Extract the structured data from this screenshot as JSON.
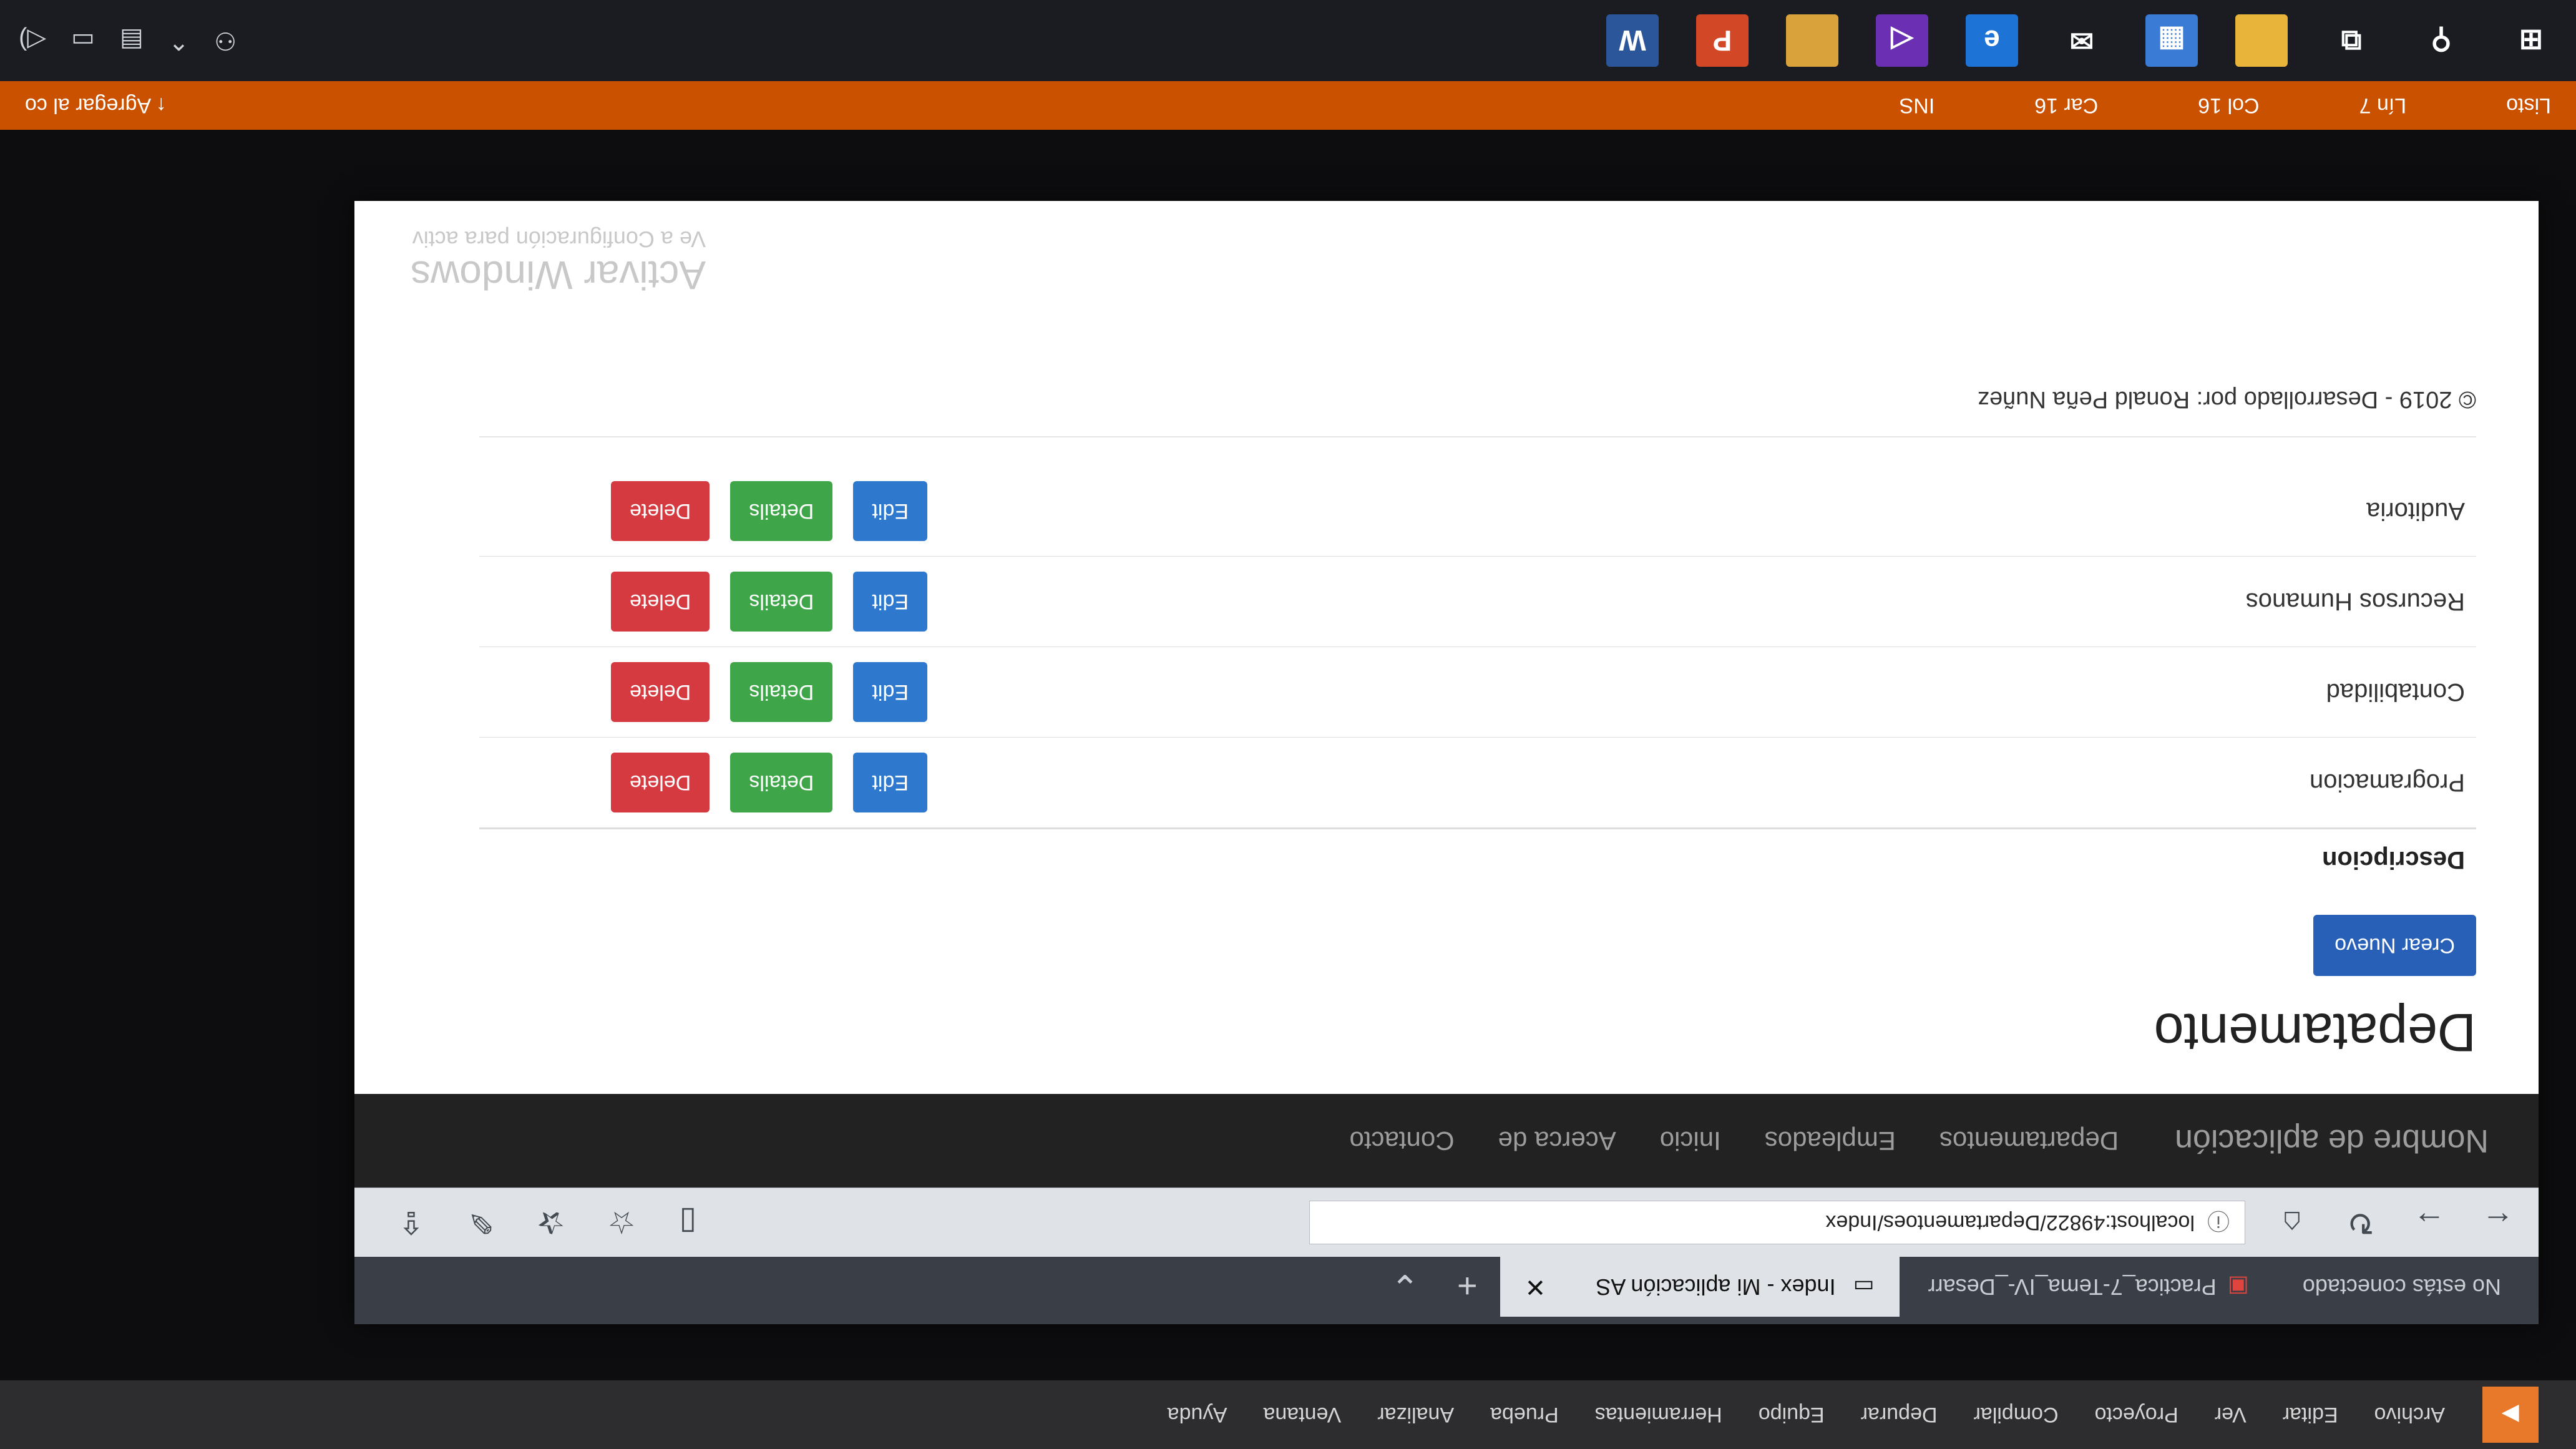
{
  "vs_menubar": {
    "items": [
      "Archivo",
      "Editar",
      "Ver",
      "Proyecto",
      "Compilar",
      "Depurar",
      "Equipo",
      "Herramientas",
      "Prueba",
      "Analizar",
      "Ventana",
      "Ayuda"
    ]
  },
  "browser": {
    "tabs": [
      {
        "label": "No estás conectado"
      },
      {
        "label": "Practica_7-Tema_IV-_Desarr"
      },
      {
        "label": "Index - Mi aplicación AS"
      }
    ],
    "address": "localhost:49822/Departamentoes/Index"
  },
  "site_nav": {
    "brand": "Nombre de aplicación",
    "links": [
      "Departamentos",
      "Empleados",
      "Inicio",
      "Acerca de",
      "Contacto"
    ]
  },
  "page": {
    "title": "Depatamento",
    "create_label": "Crear Nuevo",
    "column_header": "Descripcion",
    "rows": [
      {
        "descripcion": "Programacion"
      },
      {
        "descripcion": "Contabilidad"
      },
      {
        "descripcion": "Recursos Humanos"
      },
      {
        "descripcion": "Auditoria"
      }
    ],
    "edit_label": "Edit",
    "details_label": "Details",
    "delete_label": "Delete",
    "footer": "© 2019 - Desarrollado por: Ronald Peña Nuñez"
  },
  "watermark": {
    "line1": "Activar Windows",
    "line2": "Ve a Configuración para activ"
  },
  "vs_status": {
    "ready": "Listo",
    "line": "Lín 7",
    "col": "Col 16",
    "car": "Car 16",
    "ins": "INS",
    "source_control": "Agregar al co"
  },
  "colors": {
    "vs_status_bar": "#ca5100",
    "create_button": "#2860b8",
    "edit_button": "#2e78cd",
    "details_button": "#3ea548",
    "delete_button": "#d43a3f",
    "site_navbar": "#222222"
  }
}
